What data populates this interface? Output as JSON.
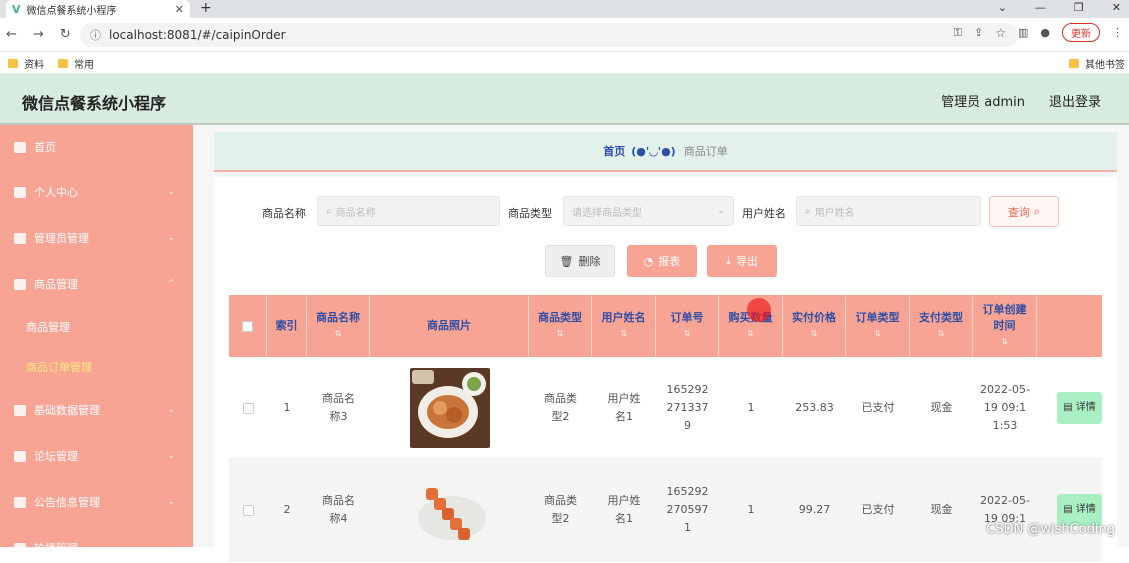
{
  "browser": {
    "tab_title": "微信点餐系统小程序",
    "tab_logo": "V",
    "new_tab": "+",
    "url": "localhost:8081/#/caipinOrder",
    "update_label": "更新",
    "bookmarks": [
      "资料",
      "常用"
    ],
    "other_bookmarks": "其他书签"
  },
  "header": {
    "title": "微信点餐系统小程序",
    "admin": "管理员 admin",
    "logout": "退出登录"
  },
  "sidebar": {
    "items": [
      {
        "label": "首页",
        "has_arrow": false
      },
      {
        "label": "个人中心",
        "has_arrow": true
      },
      {
        "label": "管理员管理",
        "has_arrow": true
      },
      {
        "label": "商品管理",
        "has_arrow": true
      },
      {
        "label": "基础数据管理",
        "has_arrow": true
      },
      {
        "label": "论坛管理",
        "has_arrow": true
      },
      {
        "label": "公告信息管理",
        "has_arrow": true
      },
      {
        "label": "轮播管理",
        "has_arrow": true
      }
    ],
    "sub_items": [
      {
        "label": "商品管理",
        "active": false
      },
      {
        "label": "商品订单管理",
        "active": true
      }
    ]
  },
  "breadcrumb": {
    "home": "首页",
    "face": "(●'◡'●)",
    "current": "商品订单"
  },
  "filters": {
    "name_label": "商品名称",
    "name_placeholder": "商品名称",
    "type_label": "商品类型",
    "type_placeholder": "请选择商品类型",
    "user_label": "用户姓名",
    "user_placeholder": "用户姓名",
    "query_button": "查询"
  },
  "actions": {
    "delete": "删除",
    "report": "报表",
    "export": "导出"
  },
  "table": {
    "columns": [
      "索引",
      "商品名称",
      "商品照片",
      "商品类型",
      "用户姓名",
      "订单号",
      "购买数量",
      "实付价格",
      "订单类型",
      "支付类型",
      "订单创建时间"
    ],
    "detail_button": "详情",
    "rows": [
      {
        "index": "1",
        "name": "商品名称3",
        "type": "商品类型2",
        "user": "用户姓名1",
        "order_no": "1652922713379",
        "qty": "1",
        "price": "253.83",
        "order_type": "已支付",
        "pay_type": "现金",
        "created": "2022-05-19 09:11:53"
      },
      {
        "index": "2",
        "name": "商品名称4",
        "type": "商品类型2",
        "user": "用户姓名1",
        "order_no": "1652922705971",
        "qty": "1",
        "price": "99.27",
        "order_type": "已支付",
        "pay_type": "现金",
        "created": "2022-05-19 09:1"
      }
    ]
  },
  "watermark": "CSDN @wishCoding",
  "colors": {
    "sidebar": "#f7a495",
    "header": "#d7ecdf",
    "table_header": "#f7a495",
    "link_blue": "#2f4ea6",
    "detail_green": "#a9efc3"
  }
}
